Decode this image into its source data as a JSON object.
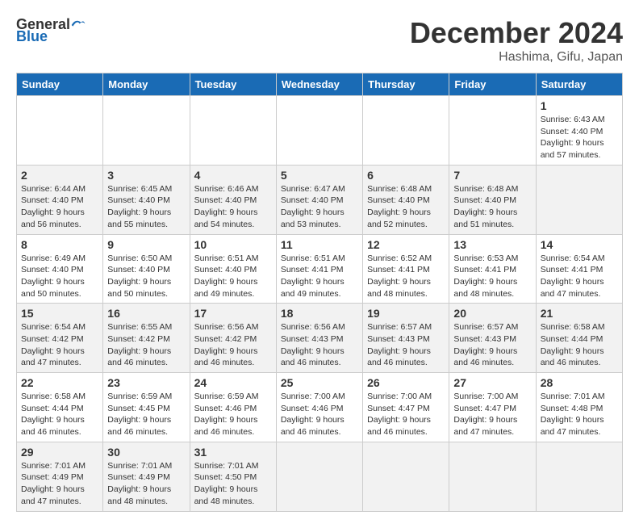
{
  "header": {
    "logo_general": "General",
    "logo_blue": "Blue",
    "month_title": "December 2024",
    "location": "Hashima, Gifu, Japan"
  },
  "calendar": {
    "days_of_week": [
      "Sunday",
      "Monday",
      "Tuesday",
      "Wednesday",
      "Thursday",
      "Friday",
      "Saturday"
    ],
    "weeks": [
      [
        null,
        null,
        null,
        null,
        null,
        null,
        {
          "day": 1,
          "sunrise": "Sunrise: 6:43 AM",
          "sunset": "Sunset: 4:40 PM",
          "daylight": "Daylight: 9 hours and 57 minutes."
        }
      ],
      [
        {
          "day": 2,
          "sunrise": "Sunrise: 6:44 AM",
          "sunset": "Sunset: 4:40 PM",
          "daylight": "Daylight: 9 hours and 56 minutes."
        },
        {
          "day": 3,
          "sunrise": "Sunrise: 6:45 AM",
          "sunset": "Sunset: 4:40 PM",
          "daylight": "Daylight: 9 hours and 55 minutes."
        },
        {
          "day": 4,
          "sunrise": "Sunrise: 6:46 AM",
          "sunset": "Sunset: 4:40 PM",
          "daylight": "Daylight: 9 hours and 54 minutes."
        },
        {
          "day": 5,
          "sunrise": "Sunrise: 6:47 AM",
          "sunset": "Sunset: 4:40 PM",
          "daylight": "Daylight: 9 hours and 53 minutes."
        },
        {
          "day": 6,
          "sunrise": "Sunrise: 6:48 AM",
          "sunset": "Sunset: 4:40 PM",
          "daylight": "Daylight: 9 hours and 52 minutes."
        },
        {
          "day": 7,
          "sunrise": "Sunrise: 6:48 AM",
          "sunset": "Sunset: 4:40 PM",
          "daylight": "Daylight: 9 hours and 51 minutes."
        }
      ],
      [
        {
          "day": 8,
          "sunrise": "Sunrise: 6:49 AM",
          "sunset": "Sunset: 4:40 PM",
          "daylight": "Daylight: 9 hours and 50 minutes."
        },
        {
          "day": 9,
          "sunrise": "Sunrise: 6:50 AM",
          "sunset": "Sunset: 4:40 PM",
          "daylight": "Daylight: 9 hours and 50 minutes."
        },
        {
          "day": 10,
          "sunrise": "Sunrise: 6:51 AM",
          "sunset": "Sunset: 4:40 PM",
          "daylight": "Daylight: 9 hours and 49 minutes."
        },
        {
          "day": 11,
          "sunrise": "Sunrise: 6:51 AM",
          "sunset": "Sunset: 4:41 PM",
          "daylight": "Daylight: 9 hours and 49 minutes."
        },
        {
          "day": 12,
          "sunrise": "Sunrise: 6:52 AM",
          "sunset": "Sunset: 4:41 PM",
          "daylight": "Daylight: 9 hours and 48 minutes."
        },
        {
          "day": 13,
          "sunrise": "Sunrise: 6:53 AM",
          "sunset": "Sunset: 4:41 PM",
          "daylight": "Daylight: 9 hours and 48 minutes."
        },
        {
          "day": 14,
          "sunrise": "Sunrise: 6:54 AM",
          "sunset": "Sunset: 4:41 PM",
          "daylight": "Daylight: 9 hours and 47 minutes."
        }
      ],
      [
        {
          "day": 15,
          "sunrise": "Sunrise: 6:54 AM",
          "sunset": "Sunset: 4:42 PM",
          "daylight": "Daylight: 9 hours and 47 minutes."
        },
        {
          "day": 16,
          "sunrise": "Sunrise: 6:55 AM",
          "sunset": "Sunset: 4:42 PM",
          "daylight": "Daylight: 9 hours and 46 minutes."
        },
        {
          "day": 17,
          "sunrise": "Sunrise: 6:56 AM",
          "sunset": "Sunset: 4:42 PM",
          "daylight": "Daylight: 9 hours and 46 minutes."
        },
        {
          "day": 18,
          "sunrise": "Sunrise: 6:56 AM",
          "sunset": "Sunset: 4:43 PM",
          "daylight": "Daylight: 9 hours and 46 minutes."
        },
        {
          "day": 19,
          "sunrise": "Sunrise: 6:57 AM",
          "sunset": "Sunset: 4:43 PM",
          "daylight": "Daylight: 9 hours and 46 minutes."
        },
        {
          "day": 20,
          "sunrise": "Sunrise: 6:57 AM",
          "sunset": "Sunset: 4:43 PM",
          "daylight": "Daylight: 9 hours and 46 minutes."
        },
        {
          "day": 21,
          "sunrise": "Sunrise: 6:58 AM",
          "sunset": "Sunset: 4:44 PM",
          "daylight": "Daylight: 9 hours and 46 minutes."
        }
      ],
      [
        {
          "day": 22,
          "sunrise": "Sunrise: 6:58 AM",
          "sunset": "Sunset: 4:44 PM",
          "daylight": "Daylight: 9 hours and 46 minutes."
        },
        {
          "day": 23,
          "sunrise": "Sunrise: 6:59 AM",
          "sunset": "Sunset: 4:45 PM",
          "daylight": "Daylight: 9 hours and 46 minutes."
        },
        {
          "day": 24,
          "sunrise": "Sunrise: 6:59 AM",
          "sunset": "Sunset: 4:46 PM",
          "daylight": "Daylight: 9 hours and 46 minutes."
        },
        {
          "day": 25,
          "sunrise": "Sunrise: 7:00 AM",
          "sunset": "Sunset: 4:46 PM",
          "daylight": "Daylight: 9 hours and 46 minutes."
        },
        {
          "day": 26,
          "sunrise": "Sunrise: 7:00 AM",
          "sunset": "Sunset: 4:47 PM",
          "daylight": "Daylight: 9 hours and 46 minutes."
        },
        {
          "day": 27,
          "sunrise": "Sunrise: 7:00 AM",
          "sunset": "Sunset: 4:47 PM",
          "daylight": "Daylight: 9 hours and 47 minutes."
        },
        {
          "day": 28,
          "sunrise": "Sunrise: 7:01 AM",
          "sunset": "Sunset: 4:48 PM",
          "daylight": "Daylight: 9 hours and 47 minutes."
        }
      ],
      [
        {
          "day": 29,
          "sunrise": "Sunrise: 7:01 AM",
          "sunset": "Sunset: 4:49 PM",
          "daylight": "Daylight: 9 hours and 47 minutes."
        },
        {
          "day": 30,
          "sunrise": "Sunrise: 7:01 AM",
          "sunset": "Sunset: 4:49 PM",
          "daylight": "Daylight: 9 hours and 48 minutes."
        },
        {
          "day": 31,
          "sunrise": "Sunrise: 7:01 AM",
          "sunset": "Sunset: 4:50 PM",
          "daylight": "Daylight: 9 hours and 48 minutes."
        },
        null,
        null,
        null,
        null
      ]
    ]
  }
}
